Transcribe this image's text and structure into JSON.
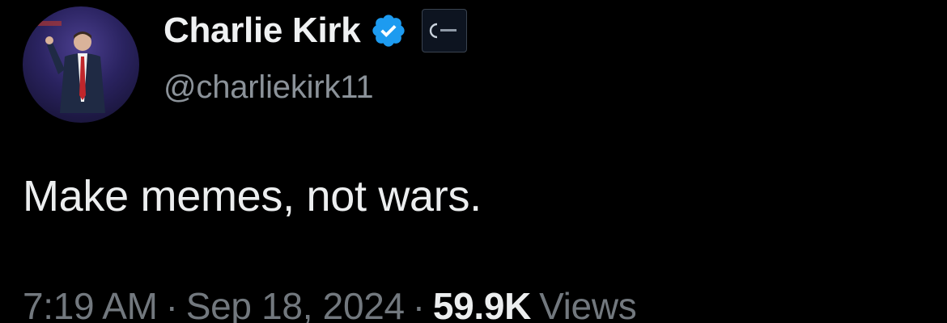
{
  "tweet": {
    "author": {
      "display_name": "Charlie Kirk",
      "handle": "@charliekirk11",
      "verified_icon": "verified-badge-icon",
      "affiliate_icon": "affiliate-org-badge-icon"
    },
    "text": "Make memes, not wars.",
    "meta": {
      "time": "7:19 AM",
      "separator": "·",
      "date": "Sep 18, 2024",
      "views_count": "59.9K",
      "views_label": "Views"
    }
  },
  "colors": {
    "background": "#000000",
    "verified_blue": "#1d9bf0",
    "secondary_text": "#8b9299"
  }
}
